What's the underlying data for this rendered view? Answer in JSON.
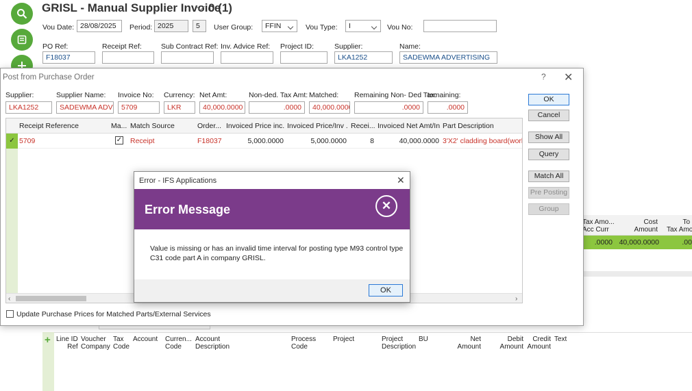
{
  "header": {
    "title": "GRISL - Manual Supplier Invoice",
    "record_info": "0 (1)",
    "vou_date_label": "Vou Date:",
    "vou_date": "28/08/2025",
    "period_label": "Period:",
    "period_year": "2025",
    "period_no": "5",
    "user_group_label": "User Group:",
    "user_group": "FFIN",
    "vou_type_label": "Vou Type:",
    "vou_type": "I",
    "vou_no_label": "Vou No:",
    "vou_no": "",
    "po_ref_label": "PO Ref:",
    "po_ref": "F18037",
    "receipt_ref_label": "Receipt Ref:",
    "receipt_ref": "",
    "sub_contract_label": "Sub Contract Ref:",
    "sub_contract": "",
    "inv_advice_label": "Inv. Advice Ref:",
    "inv_advice": "",
    "project_id_label": "Project ID:",
    "project_id": "",
    "supplier_label": "Supplier:",
    "supplier": "LKA1252",
    "name_label": "Name:",
    "name": "SADEWMA ADVERTISING"
  },
  "post_dialog": {
    "title": "Post from Purchase Order",
    "help": "?",
    "fields": {
      "supplier_label": "Supplier:",
      "supplier": "LKA1252",
      "supplier_name_label": "Supplier Name:",
      "supplier_name": "SADEWMA ADVERT",
      "invoice_no_label": "Invoice No:",
      "invoice_no": "5709",
      "currency_label": "Currency:",
      "currency": "LKR",
      "net_amt_label": "Net Amt:",
      "net_amt": "40,000.0000",
      "nonded_tax_label": "Non-ded. Tax Amt:",
      "nonded_tax": ".0000",
      "matched_label": "Matched:",
      "matched": "40,000.0000",
      "remaining_label": "Remaining Non- Ded Tax:",
      "remaining": ".0000",
      "remaining2_label": "temaining:",
      "remaining2": ".0000"
    },
    "columns": [
      "Receipt Reference",
      "Ma...",
      "Match Source",
      "Order...",
      "Invoiced Price inc...",
      "Invoiced Price/Inv ...",
      "Recei...",
      "Invoiced Net Amt/In...",
      "Part Description"
    ],
    "row": {
      "receipt_ref": "5709",
      "match_source": "Receipt",
      "order": "F18037",
      "price_inc": "5,000.0000",
      "price_inv": "5,000.0000",
      "received": "8",
      "net_amt": "40,000.0000",
      "part_desc": "3'X2' cladding board(workin"
    },
    "update_prices_label": "Update Purchase Prices for Matched Parts/External Services",
    "buttons": {
      "ok": "OK",
      "cancel": "Cancel",
      "show_all": "Show All",
      "query": "Query",
      "match_all": "Match All",
      "pre_posting": "Pre Posting",
      "group": "Group"
    }
  },
  "right_panel": {
    "tax_amount_line1": "Tax Amo...",
    "tax_amount_line2": "Acc Curr",
    "cost_amount_line1": "Cost",
    "cost_amount_line2": "Amount",
    "tax_amo2_line1": "To",
    "tax_amo2_line2": "Tax Amo",
    "tax_value": ".0000",
    "cost_value": "40,000.0000",
    "tax2_value": ".00"
  },
  "lines_grid": {
    "columns": [
      [
        "Line ID",
        "Ref"
      ],
      [
        "Voucher",
        "Company"
      ],
      [
        "Tax",
        "Code"
      ],
      [
        "Account",
        ""
      ],
      [
        "Curren...",
        "Code"
      ],
      [
        "Account",
        "Description"
      ],
      [
        "Process",
        "Code"
      ],
      [
        "Project",
        ""
      ],
      [
        "Project",
        "Description"
      ],
      [
        "BU",
        ""
      ],
      [
        "Net",
        "Amount"
      ],
      [
        "Debit",
        "Amount"
      ],
      [
        "Credit",
        "Amount"
      ],
      [
        "Text",
        ""
      ]
    ]
  },
  "error_dialog": {
    "window_title": "Error - IFS Applications",
    "heading": "Error Message",
    "message": "Value is missing or has an invalid time interval for posting type M93 control type C31 code part A in company GRISL.",
    "ok": "OK",
    "accent": "#7b3b8a"
  },
  "colors": {
    "accent_green": "#57a93b",
    "error_purple": "#7b3b8a",
    "row_green": "#8cc63f"
  }
}
